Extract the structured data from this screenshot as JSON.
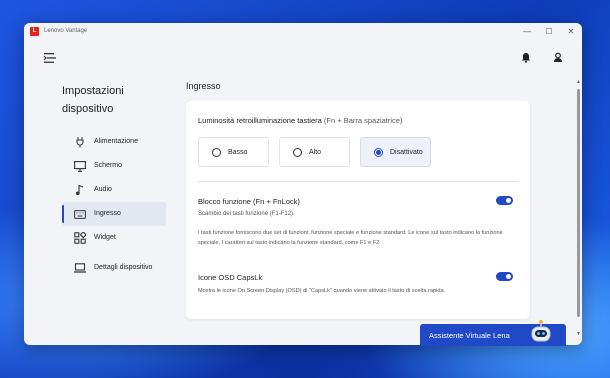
{
  "app": {
    "logo_letter": "L",
    "title": "Lenovo Vantage",
    "window_controls": [
      "—",
      "☐",
      "✕"
    ]
  },
  "sidebar": {
    "title": "Impostazioni dispositivo",
    "items": [
      {
        "label": "Alimentazione",
        "icon": "power-plug-icon",
        "active": false
      },
      {
        "label": "Schermo",
        "icon": "monitor-icon",
        "active": false
      },
      {
        "label": "Audio",
        "icon": "music-note-icon",
        "active": false
      },
      {
        "label": "Ingresso",
        "icon": "keyboard-icon",
        "active": true
      },
      {
        "label": "Widget",
        "icon": "widget-grid-icon",
        "active": false
      },
      {
        "label": "Dettagli dispositivo",
        "icon": "laptop-icon",
        "active": false
      }
    ]
  },
  "content": {
    "section_title": "Ingresso",
    "backlight": {
      "heading": "Luminosità retroilluminazione tastiera",
      "heading_sub": "(Fn + Barra spaziatrice)",
      "options": [
        "Basso",
        "Alto",
        "Disattivato"
      ],
      "selected": "Disattivato"
    },
    "fnlock": {
      "title": "Blocco funzione (Fn + FnLock)",
      "subtitle": "Scambio dei tasti funzione (F1-F12).",
      "description": "I tasti funzione forniscono due set di funzioni: funzione speciale e funzione standard. Le icone sul tasto indicano la funzione speciale, I caratteri sul tasto indicano la funzione standard, come F1 e F2.",
      "enabled": true
    },
    "capslock_osd": {
      "title": "Icone OSD CapsLk",
      "description": "Mostra le icone On Screen Display (OSD) di \"CapsLk\" quando viene attivato il tasto di scelta rapida.",
      "enabled": true
    }
  },
  "assistant": {
    "label": "Assistente Virtuale Lena"
  },
  "colors": {
    "accent": "#1f49c6",
    "brand_red": "#e2231a",
    "window_bg": "#f3f4f8"
  }
}
